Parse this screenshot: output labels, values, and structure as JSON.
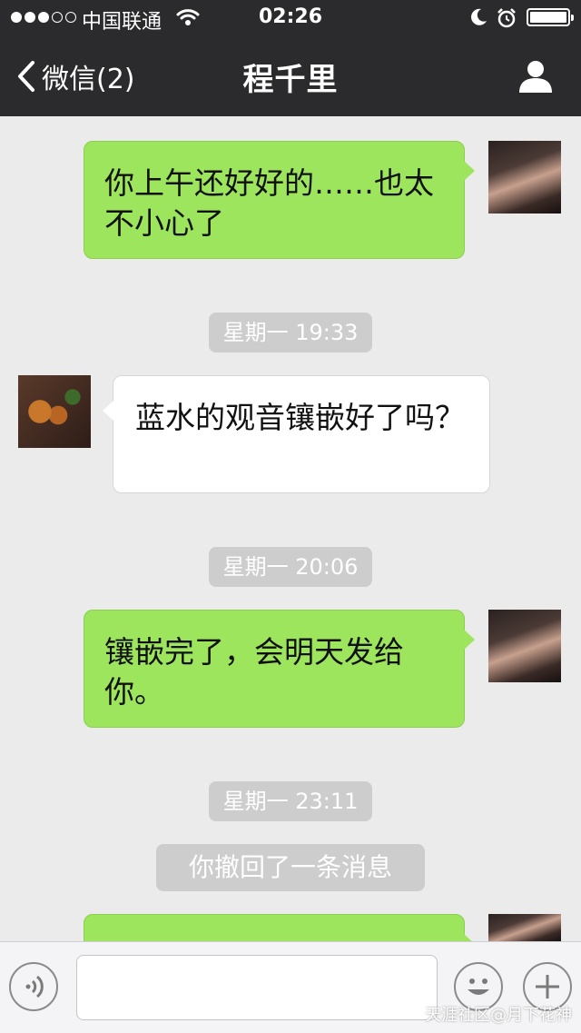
{
  "status_bar": {
    "signal_bars": 5,
    "signal_filled": 3,
    "carrier": "中国联通",
    "time": "02:26",
    "icons": [
      "wifi-icon",
      "moon-icon",
      "alarm-icon",
      "battery-icon"
    ],
    "battery_level": 1.0
  },
  "nav": {
    "back_label": "微信(2)",
    "title": "程千里",
    "right_icon": "person-icon"
  },
  "messages": [
    {
      "type": "sent",
      "text": "你上午还好好的……也太不小心了"
    },
    {
      "type": "time",
      "text": "星期一 19:33"
    },
    {
      "type": "received",
      "text": "蓝水的观音镶嵌好了吗？"
    },
    {
      "type": "time",
      "text": "星期一 20:06"
    },
    {
      "type": "sent",
      "text": "镶嵌完了，会明天发给你。"
    },
    {
      "type": "time",
      "text": "星期一 23:11"
    },
    {
      "type": "notice",
      "text": "你撤回了一条消息"
    },
    {
      "type": "sent",
      "text": ""
    }
  ],
  "input_bar": {
    "left_icon": "voice-icon",
    "input_value": "",
    "icons": [
      "emoji-icon",
      "plus-icon"
    ]
  },
  "watermark": "天涯社区@月下花神",
  "colors": {
    "nav_bg": "#2b2b2d",
    "sent_bubble": "#9de55d",
    "received_bubble": "#ffffff",
    "chat_bg": "#ebebeb",
    "time_pill": "#cdcdcd"
  }
}
